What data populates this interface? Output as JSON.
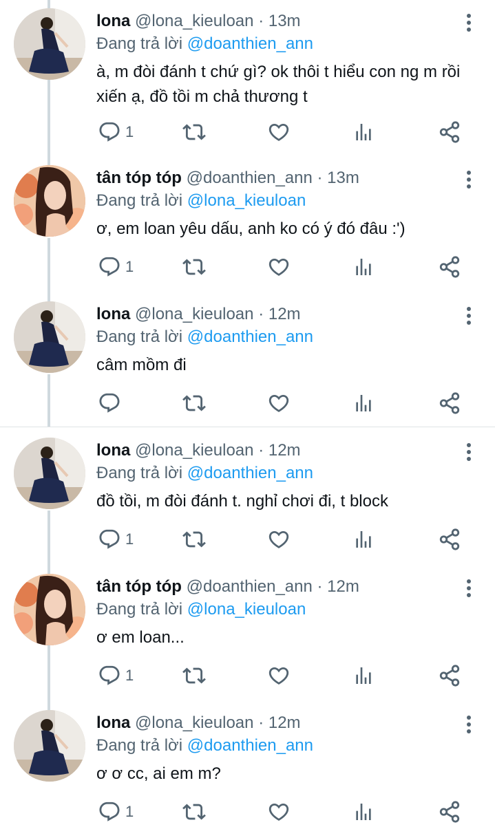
{
  "tweets": [
    {
      "avatar": "lona",
      "name": "lona",
      "handle": "@lona_kieuloan",
      "time": "· 13m",
      "replying_label": "Đang trả lời",
      "replying_to": "@doanthien_ann",
      "text": "à, m đòi đánh t chứ gì? ok thôi t hiểu con ng m rồi xiến ạ, đồ tồi m chả thương t",
      "reply_count": "1"
    },
    {
      "avatar": "tan",
      "name": "tân tóp tóp",
      "handle": "@doanthien_ann",
      "time": "· 13m",
      "replying_label": "Đang trả lời",
      "replying_to": "@lona_kieuloan",
      "text": "ơ, em loan yêu dấu, anh ko có ý đó đâu :')",
      "reply_count": "1"
    },
    {
      "avatar": "lona",
      "name": "lona",
      "handle": "@lona_kieuloan",
      "time": "· 12m",
      "replying_label": "Đang trả lời",
      "replying_to": "@doanthien_ann",
      "text": "câm mồm đi",
      "reply_count": ""
    },
    {
      "avatar": "lona",
      "name": "lona",
      "handle": "@lona_kieuloan",
      "time": "· 12m",
      "replying_label": "Đang trả lời",
      "replying_to": "@doanthien_ann",
      "text": "đồ tồi, m đòi đánh t. nghỉ chơi đi, t block",
      "reply_count": "1"
    },
    {
      "avatar": "tan",
      "name": "tân tóp tóp",
      "handle": "@doanthien_ann",
      "time": "· 12m",
      "replying_label": "Đang trả lời",
      "replying_to": "@lona_kieuloan",
      "text": "ơ em loan...",
      "reply_count": "1"
    },
    {
      "avatar": "lona",
      "name": "lona",
      "handle": "@lona_kieuloan",
      "time": "· 12m",
      "replying_label": "Đang trả lời",
      "replying_to": "@doanthien_ann",
      "text": "ơ ơ cc, ai em m?",
      "reply_count": "1"
    }
  ],
  "icons": {
    "reply": "reply-icon",
    "retweet": "retweet-icon",
    "like": "like-icon",
    "views": "views-icon",
    "share": "share-icon",
    "more": "more-icon"
  },
  "colors": {
    "mention": "#1d9bf0",
    "secondary": "#536471",
    "thread_line": "#cfd9de"
  }
}
